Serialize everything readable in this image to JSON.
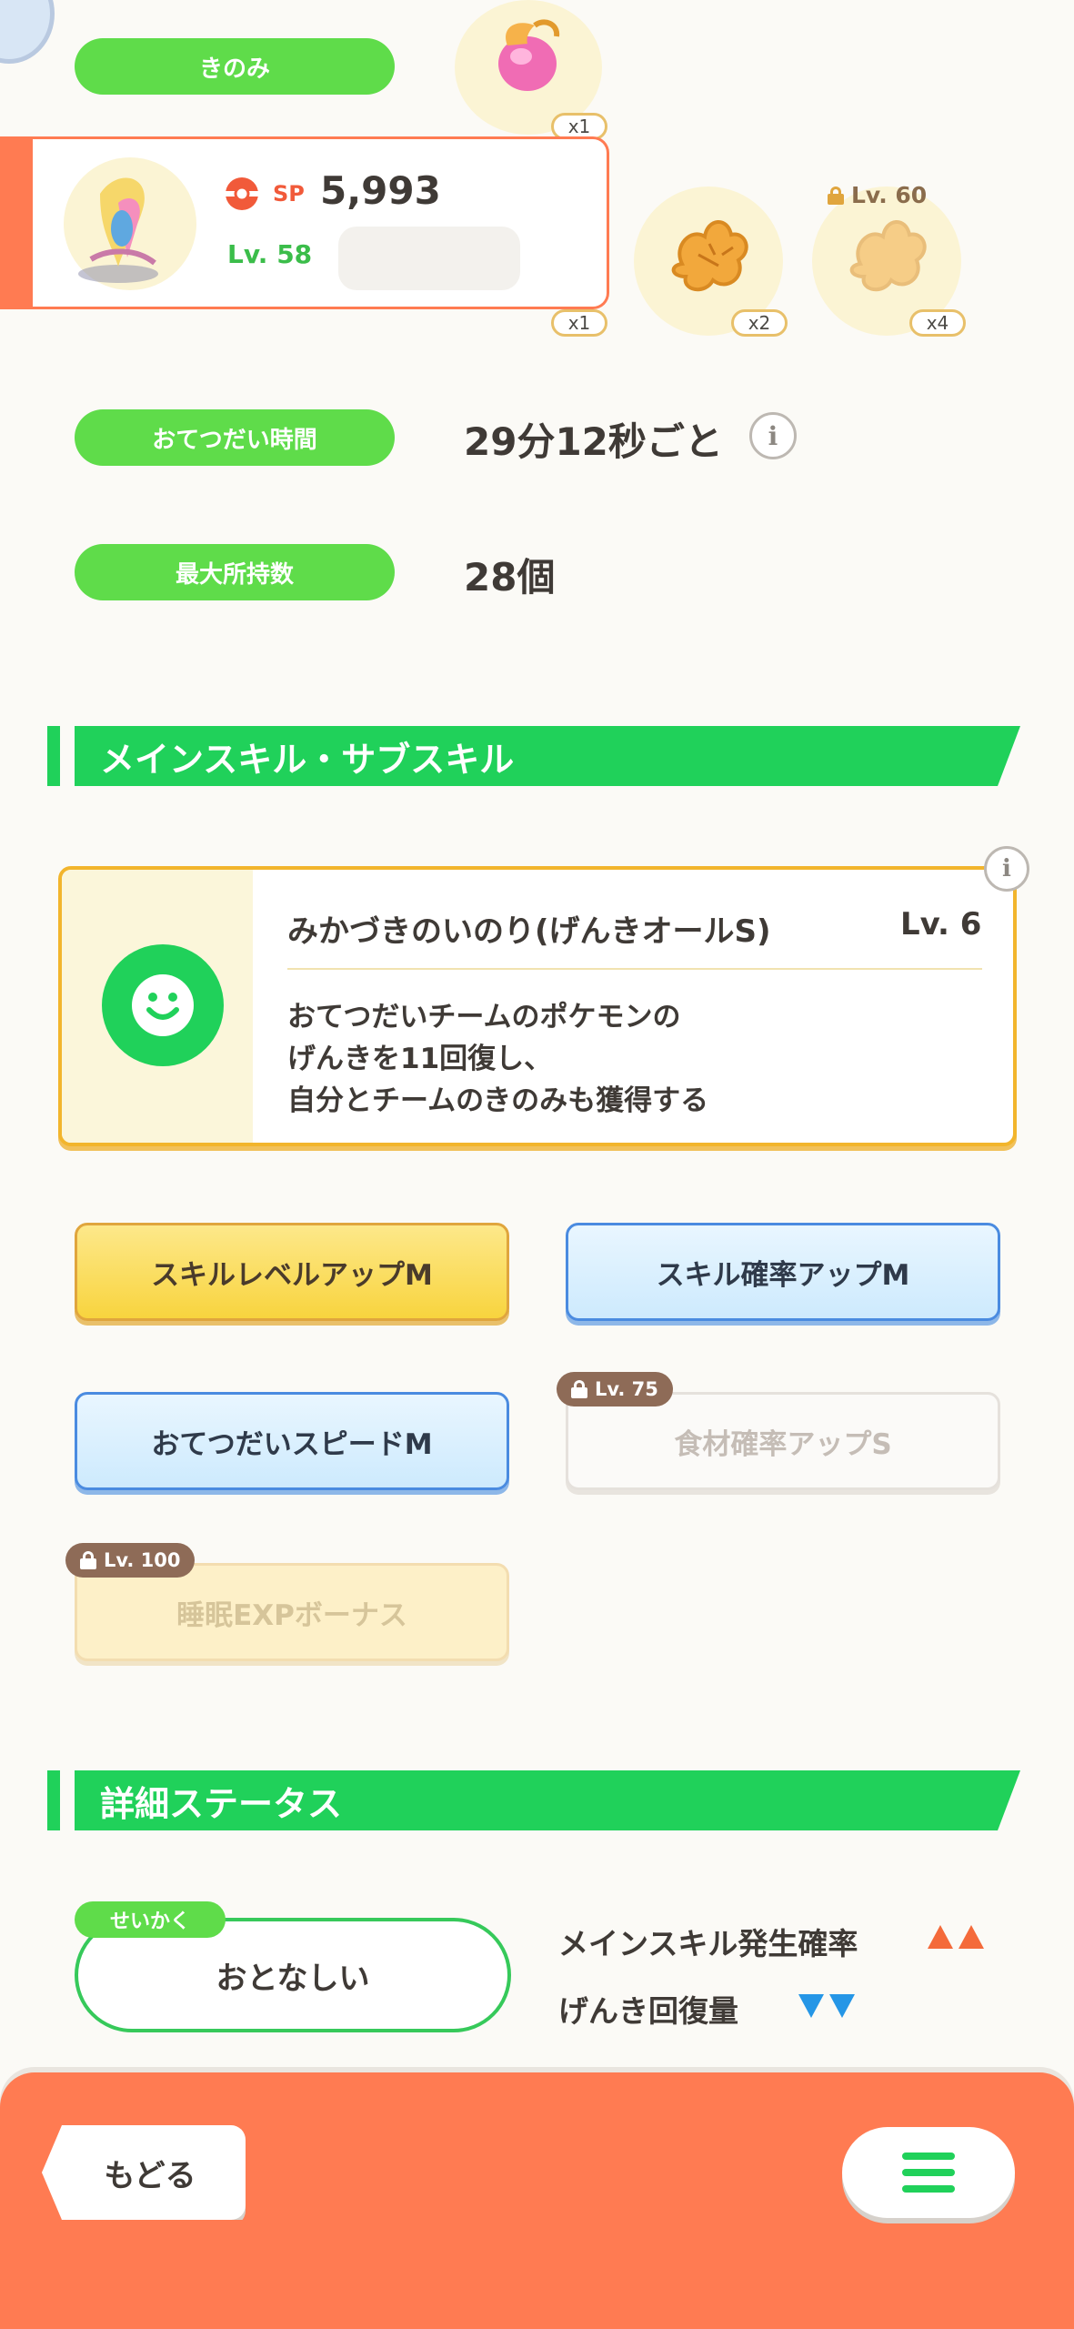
{
  "berries_label": "きのみ",
  "counts": {
    "top": "x1",
    "mid": "x1",
    "ing2": "x2",
    "ing3": "x4"
  },
  "ingredient_lock_level": "Lv. 60",
  "pokemon_card": {
    "sp_label": "SP",
    "sp_value": "5,993",
    "level": "Lv. 58"
  },
  "help_time": {
    "label": "おてつだい時間",
    "value": "29分12秒ごと"
  },
  "max_carry": {
    "label": "最大所持数",
    "value": "28個"
  },
  "skills_heading": "メインスキル・サブスキル",
  "main_skill": {
    "name": "みかづきのいのり(げんきオールS)",
    "level": "Lv. 6",
    "desc_line1": "おてつだいチームのポケモンの",
    "desc_line2": "げんきを11回復し、",
    "desc_line3": "自分とチームのきのみも獲得する"
  },
  "sub_skills": [
    {
      "label": "スキルレベルアップM"
    },
    {
      "label": "スキル確率アップM"
    },
    {
      "label": "おてつだいスピードM"
    },
    {
      "label": "食材確率アップS",
      "lock": "Lv. 75"
    },
    {
      "label": "睡眠EXPボーナス",
      "lock": "Lv. 100"
    }
  ],
  "details_heading": "詳細ステータス",
  "nature": {
    "tag": "せいかく",
    "value": "おとなしい",
    "up_label": "メインスキル発生確率",
    "down_label": "げんき回復量"
  },
  "footer": {
    "back_label": "もどる"
  },
  "colors": {
    "green": "#20d15a",
    "pill_green": "#5fdc4a",
    "orange": "#ff7b52",
    "yellow": "#f8d43e",
    "blue": "#4a8be0"
  }
}
